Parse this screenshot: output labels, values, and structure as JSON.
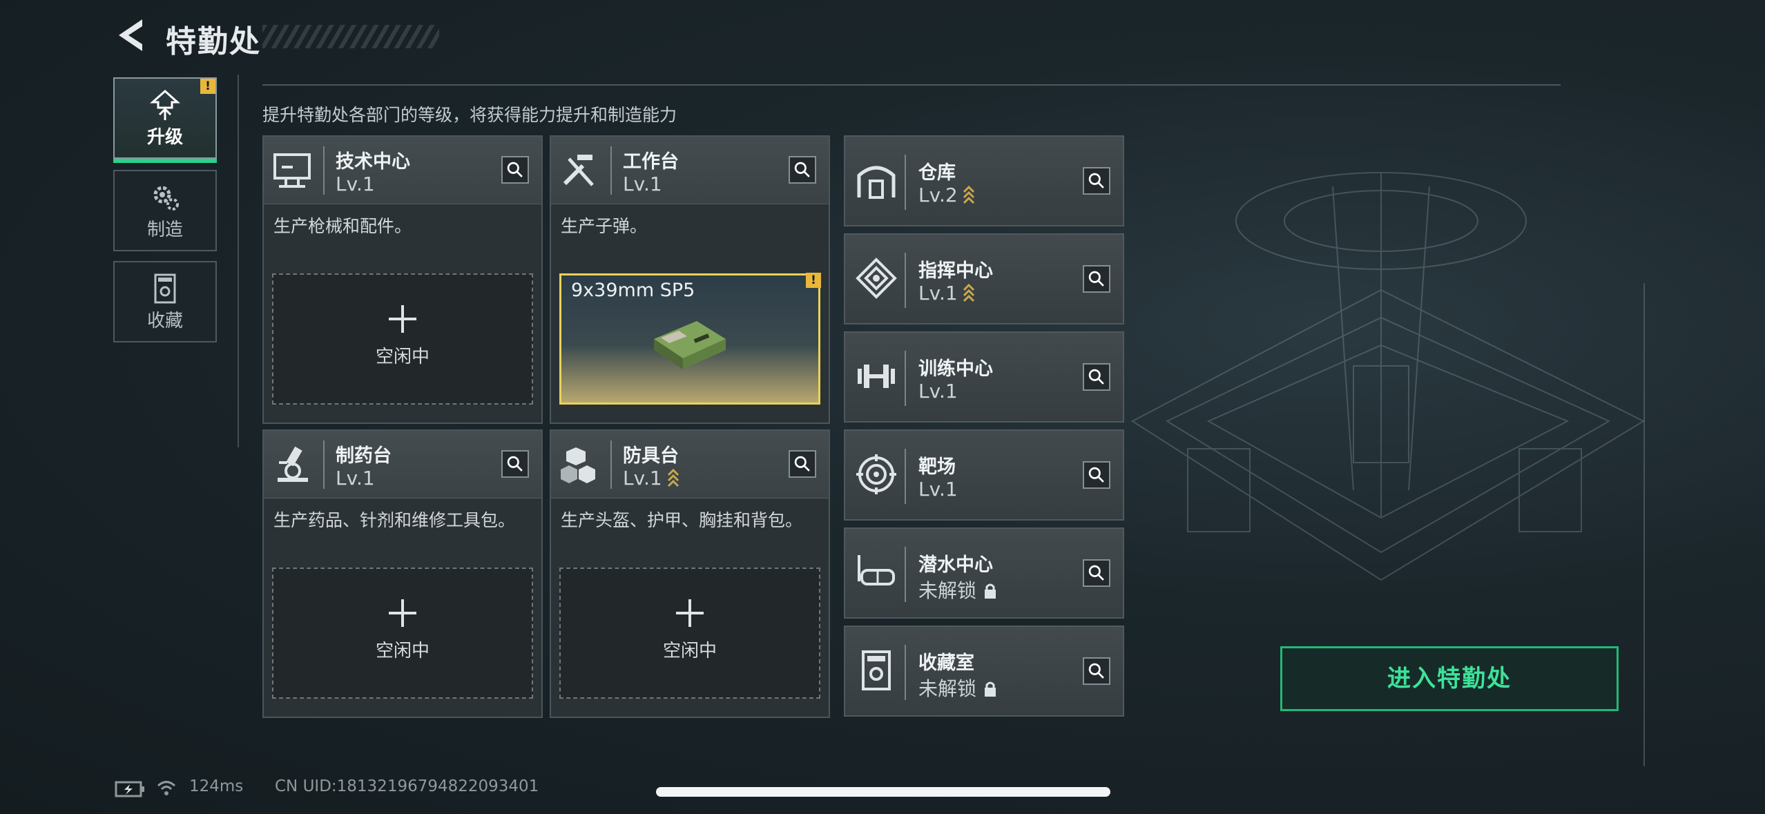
{
  "header": {
    "title": "特勤处"
  },
  "hint": "提升特勤处各部门的等级，将获得能力提升和制造能力",
  "nav": [
    {
      "label": "升级",
      "icon": "upgrade-icon",
      "active": true,
      "alert": "!"
    },
    {
      "label": "制造",
      "icon": "gears-icon",
      "active": false
    },
    {
      "label": "收藏",
      "icon": "collection-icon",
      "active": false
    }
  ],
  "cards": [
    {
      "name": "技术中心",
      "level": "Lv.1",
      "desc": "生产枪械和配件。",
      "slot": "空闲中",
      "icon": "monitor-icon"
    },
    {
      "name": "工作台",
      "level": "Lv.1",
      "desc": "生产子弹。",
      "slot_item": "9x39mm SP5",
      "alert": "!",
      "icon": "tools-icon"
    },
    {
      "name": "制药台",
      "level": "Lv.1",
      "desc": "生产药品、针剂和维修工具包。",
      "slot": "空闲中",
      "icon": "microscope-icon"
    },
    {
      "name": "防具台",
      "level": "Lv.1",
      "desc": "生产头盔、护甲、胸挂和背包。",
      "slot": "空闲中",
      "icon": "armor-blocks-icon",
      "upgradable": true
    }
  ],
  "facilities": [
    {
      "name": "仓库",
      "level": "Lv.2",
      "upgradable": true,
      "locked": false,
      "icon": "warehouse-icon"
    },
    {
      "name": "指挥中心",
      "level": "Lv.1",
      "upgradable": true,
      "locked": false,
      "icon": "command-icon"
    },
    {
      "name": "训练中心",
      "level": "Lv.1",
      "upgradable": false,
      "locked": false,
      "icon": "dumbbell-icon"
    },
    {
      "name": "靶场",
      "level": "Lv.1",
      "upgradable": false,
      "locked": false,
      "icon": "target-icon"
    },
    {
      "name": "潜水中心",
      "level": "未解锁",
      "upgradable": false,
      "locked": true,
      "icon": "dive-mask-icon"
    },
    {
      "name": "收藏室",
      "level": "未解锁",
      "upgradable": false,
      "locked": true,
      "icon": "collection-room-icon"
    }
  ],
  "enter_button": "进入特勤处",
  "footer": {
    "ping": "124ms",
    "uid": "CN UID:18132196794822093401"
  },
  "colors": {
    "accent": "#29d18a",
    "enter_text": "#3ee29a",
    "alert": "#e9b83a",
    "item_border": "#e9d25a",
    "upgrade_chevron": "#c9a84a"
  }
}
